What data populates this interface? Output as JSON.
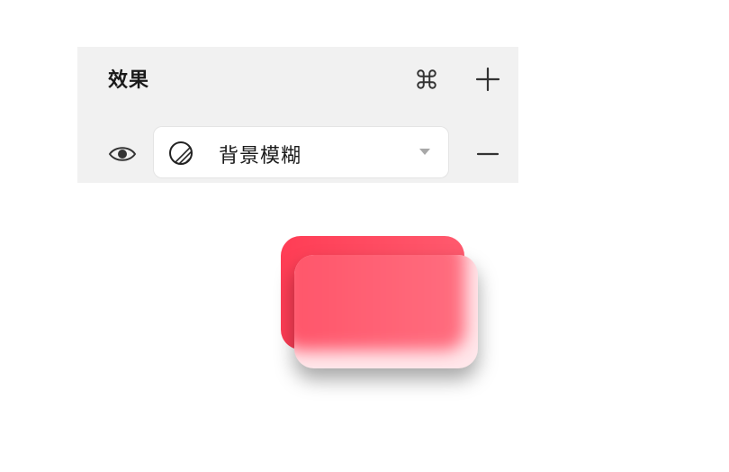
{
  "effects_panel": {
    "title": "效果",
    "shortcut_icon": "command-icon",
    "add_icon": "plus-icon",
    "effect_row": {
      "visibility_icon": "eye-icon",
      "effect_type_icon": "background-blur-icon",
      "effect_type_label": "背景模糊",
      "remove_icon": "minus-icon"
    }
  },
  "colors": {
    "panel_bg": "#f1f1f1",
    "card_red": "#ff4d61"
  }
}
